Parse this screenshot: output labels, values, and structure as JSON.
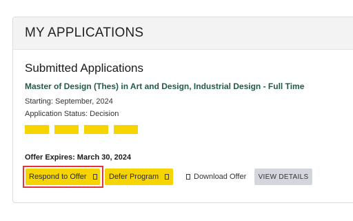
{
  "card": {
    "title": "MY APPLICATIONS"
  },
  "section": {
    "title": "Submitted Applications"
  },
  "application": {
    "program": "Master of Design (Thes) in Art and Design, Industrial Design - Full Time",
    "starting": "Starting: September, 2024",
    "status": "Application Status: Decision",
    "stage_bars_filled": 4,
    "stage_bar_color": "#f5d400"
  },
  "offer": {
    "expires": "Offer Expires: March 30, 2024"
  },
  "actions": {
    "respond_label": "Respond to Offer",
    "defer_label": "Defer Program",
    "download_label": "Download Offer",
    "view_details_label": "VIEW DETAILS",
    "external_icon": "external-link-icon",
    "download_icon": "document-icon",
    "highlight_color": "#e8323a"
  }
}
